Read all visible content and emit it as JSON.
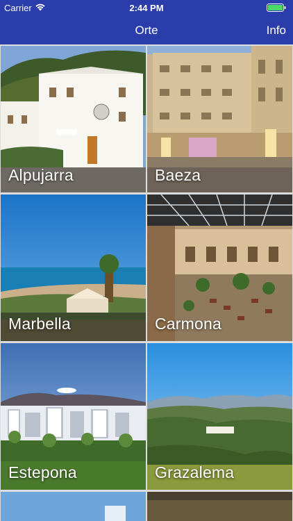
{
  "status": {
    "carrier": "Carrier",
    "time": "2:44 PM",
    "icons": [
      "wifi-icon",
      "battery-icon"
    ]
  },
  "nav": {
    "title": "Orte",
    "info": "Info",
    "bar_color": "#2a3dab"
  },
  "places": [
    {
      "name": "Alpujarra"
    },
    {
      "name": "Baeza"
    },
    {
      "name": "Marbella"
    },
    {
      "name": "Carmona"
    },
    {
      "name": "Estepona"
    },
    {
      "name": "Grazalema"
    }
  ]
}
